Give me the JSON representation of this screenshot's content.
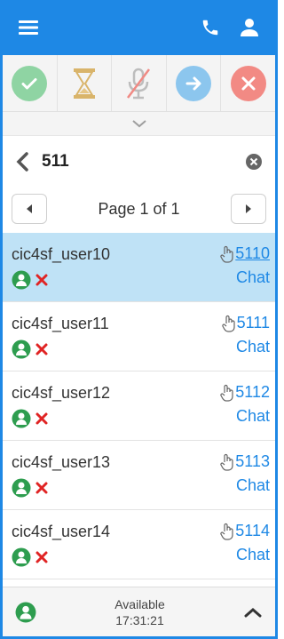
{
  "toolbar": {
    "menu_icon": "hamburger-icon",
    "phone_icon": "phone-icon",
    "user_icon": "user-icon"
  },
  "actions": [
    {
      "name": "pickup",
      "icon": "check-icon",
      "color": "#8fd4a3"
    },
    {
      "name": "hold",
      "icon": "hourglass-icon",
      "color": "#e6c686"
    },
    {
      "name": "mute",
      "icon": "microphone-muted-icon",
      "color": "#c8c8c8"
    },
    {
      "name": "transfer",
      "icon": "arrow-right-icon",
      "color": "#8cc6ee"
    },
    {
      "name": "disconnect",
      "icon": "close-icon",
      "color": "#f28a84"
    }
  ],
  "search": {
    "query": "511"
  },
  "pager": {
    "label": "Page 1 of 1"
  },
  "users": [
    {
      "name": "cic4sf_user10",
      "extension": "5110",
      "chat": "Chat",
      "selected": true
    },
    {
      "name": "cic4sf_user11",
      "extension": "5111",
      "chat": "Chat",
      "selected": false
    },
    {
      "name": "cic4sf_user12",
      "extension": "5112",
      "chat": "Chat",
      "selected": false
    },
    {
      "name": "cic4sf_user13",
      "extension": "5113",
      "chat": "Chat",
      "selected": false
    },
    {
      "name": "cic4sf_user14",
      "extension": "5114",
      "chat": "Chat",
      "selected": false
    }
  ],
  "footer": {
    "status": "Available",
    "time": "17:31:21"
  },
  "colors": {
    "brand": "#1e88e5",
    "selected_row": "#bfe2f6",
    "available_green": "#2e9d4f",
    "unavailable_red": "#e02424"
  }
}
